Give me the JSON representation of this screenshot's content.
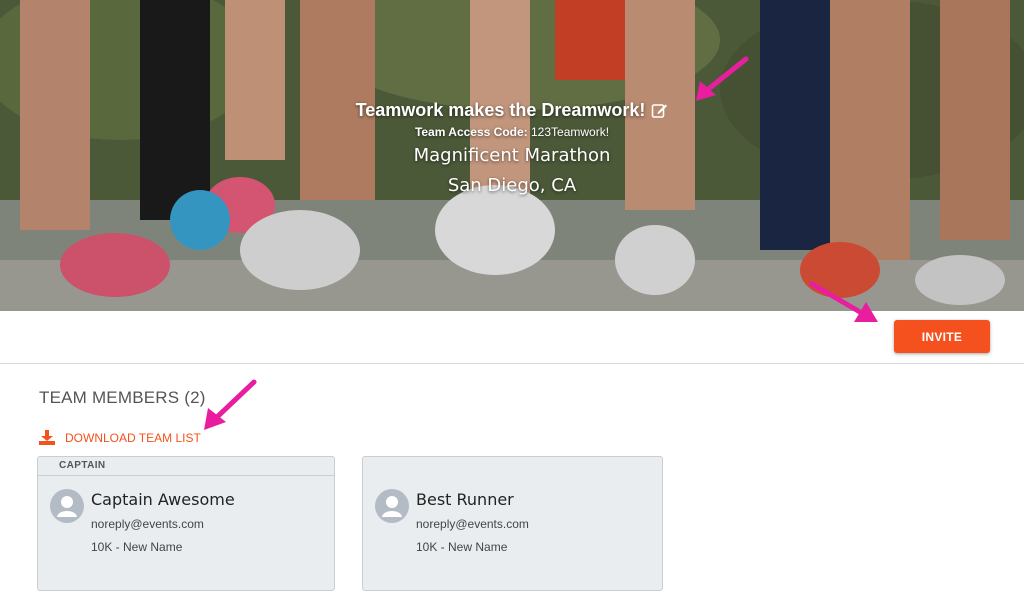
{
  "hero": {
    "team_name": "Teamwork makes the Dreamwork!",
    "access_label": "Team Access Code:",
    "access_code": "123Teamwork!",
    "event_name": "Magnificent Marathon",
    "event_location": "San Diego, CA",
    "edit_icon": "edit-icon"
  },
  "actions": {
    "invite_label": "INVITE"
  },
  "team": {
    "section_title": "TEAM MEMBERS (2)",
    "download_label": "DOWNLOAD TEAM LIST",
    "download_icon": "download-icon",
    "members": [
      {
        "badge": "CAPTAIN",
        "name": "Captain Awesome",
        "email": "noreply@events.com",
        "race": "10K - New Name"
      },
      {
        "badge": "",
        "name": "Best Runner",
        "email": "noreply@events.com",
        "race": "10K - New Name"
      }
    ]
  },
  "colors": {
    "accent": "#f4511e",
    "annotation_arrow": "#e91e9f",
    "card_bg": "#eaedf0"
  }
}
